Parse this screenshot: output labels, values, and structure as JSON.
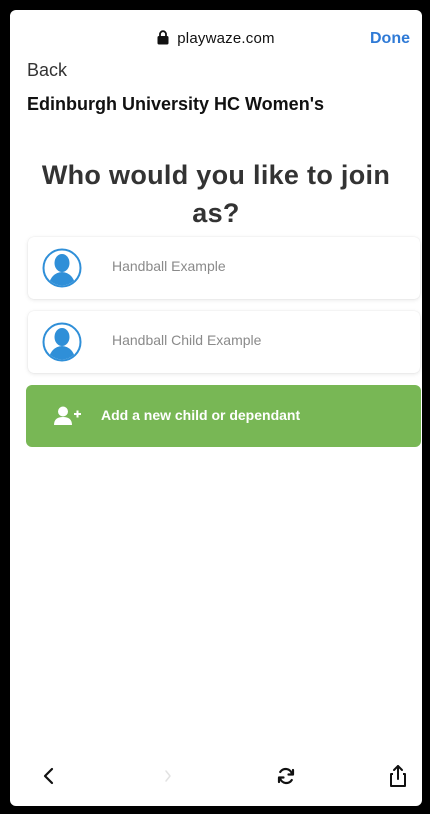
{
  "browser": {
    "url": "playwaze.com",
    "done_label": "Done"
  },
  "page": {
    "back_label": "Back",
    "club_name": "Edinburgh University HC Women's",
    "heading": "Who would you like to join as?",
    "members": [
      {
        "name": "Handball Example"
      },
      {
        "name": "Handball Child Example"
      }
    ],
    "add_button_label": "Add a new child or dependant"
  },
  "colors": {
    "accent_green": "#78b755",
    "avatar_blue": "#2f8fd8",
    "link_blue": "#2f7ad6"
  },
  "icons": {
    "lock": "lock-icon",
    "avatar": "user-avatar-icon",
    "add_user": "add-user-icon",
    "back": "chevron-left-icon",
    "forward": "chevron-right-icon",
    "reload": "reload-icon",
    "share": "share-icon"
  }
}
